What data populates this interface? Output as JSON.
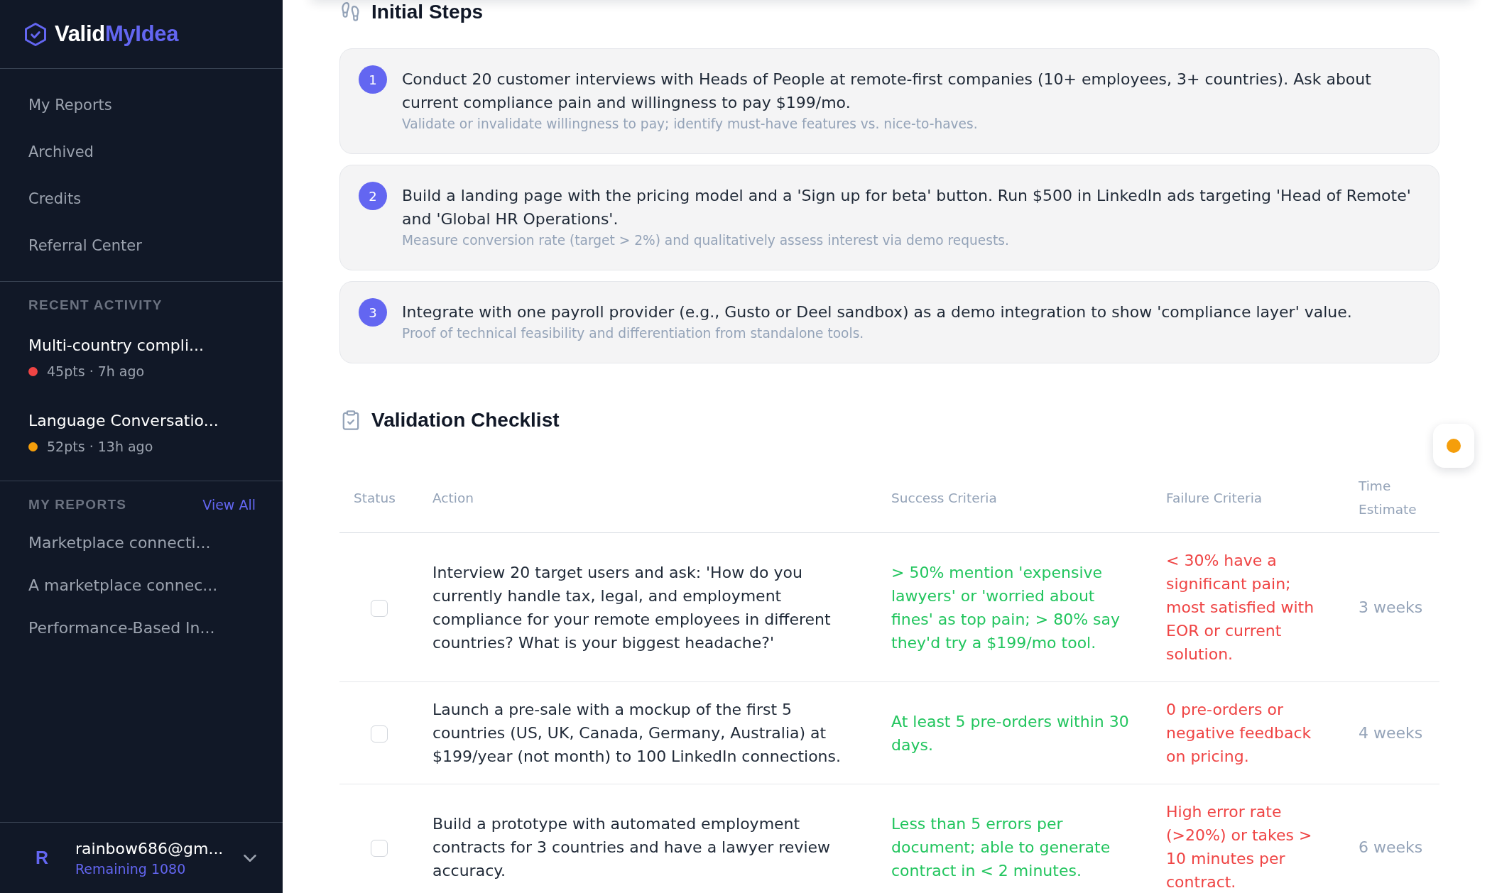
{
  "sidebar": {
    "brand": [
      {
        "text": "Valid",
        "highlighted": false
      },
      {
        "text": "MyIdea",
        "highlighted": true
      }
    ],
    "nav": [
      {
        "label": "My Reports"
      },
      {
        "label": "Archived"
      },
      {
        "label": "Credits"
      },
      {
        "label": "Referral Center"
      }
    ],
    "recent_activity": {
      "heading": "RECENT ACTIVITY",
      "items": [
        {
          "title": "Multi-country compli...",
          "meta": "45pts · 7h ago",
          "color": "#ef4444"
        },
        {
          "title": "Language Conversatio...",
          "meta": "52pts · 13h ago",
          "color": "#f59e0b"
        }
      ]
    },
    "my_reports": {
      "heading": "MY REPORTS",
      "link": "View All",
      "items": [
        {
          "title": "Marketplace connecti..."
        },
        {
          "title": "A marketplace connec..."
        },
        {
          "title": "Performance-Based In..."
        }
      ]
    },
    "account": {
      "avatar_initial": "R",
      "email": "rainbow686@gm...",
      "remaining": "Remaining 1080"
    }
  },
  "initial_steps": {
    "title": "Initial Steps",
    "steps": [
      {
        "number": "1",
        "text": "Conduct 20 customer interviews with Heads of People at remote-first companies (10+ employees, 3+ countries). Ask about current compliance pain and willingness to pay $199/mo.",
        "note": "Validate or invalidate willingness to pay; identify must-have features vs. nice-to-haves."
      },
      {
        "number": "2",
        "text": "Build a landing page with the pricing model and a 'Sign up for beta' button. Run $500 in LinkedIn ads targeting 'Head of Remote' and 'Global HR Operations'.",
        "note": "Measure conversion rate (target > 2%) and qualitatively assess interest via demo requests."
      },
      {
        "number": "3",
        "text": "Integrate with one payroll provider (e.g., Gusto or Deel sandbox) as a demo integration to show 'compliance layer' value.",
        "note": "Proof of technical feasibility and differentiation from standalone tools."
      }
    ]
  },
  "validation_checklist": {
    "title": "Validation Checklist",
    "columns": [
      "Status",
      "Action",
      "Success Criteria",
      "Failure Criteria",
      "Time Estimate"
    ],
    "rows": [
      {
        "checked": false,
        "action": "Interview 20 target users and ask: 'How do you currently handle tax, legal, and employment compliance for your remote employees in different countries? What is your biggest headache?'",
        "success_criteria": "> 50% mention 'expensive lawyers' or 'worried about fines' as top pain; > 80% say they'd try a $199/mo tool.",
        "failure_criteria": "< 30% have a significant pain; most satisfied with EOR or current solution.",
        "time_estimate": "3 weeks"
      },
      {
        "checked": false,
        "action": "Launch a pre-sale with a mockup of the first 5 countries (US, UK, Canada, Germany, Australia) at $199/year (not month) to 100 LinkedIn connections.",
        "success_criteria": "At least 5 pre-orders within 30 days.",
        "failure_criteria": "0 pre-orders or negative feedback on pricing.",
        "time_estimate": "4 weeks"
      },
      {
        "checked": false,
        "action": "Build a prototype with automated employment contracts for 3 countries and have a lawyer review accuracy.",
        "success_criteria": "Less than 5 errors per document; able to generate contract in < 2 minutes.",
        "failure_criteria": "High error rate (>20%) or takes > 10 minutes per contract.",
        "time_estimate": "6 weeks"
      }
    ]
  }
}
